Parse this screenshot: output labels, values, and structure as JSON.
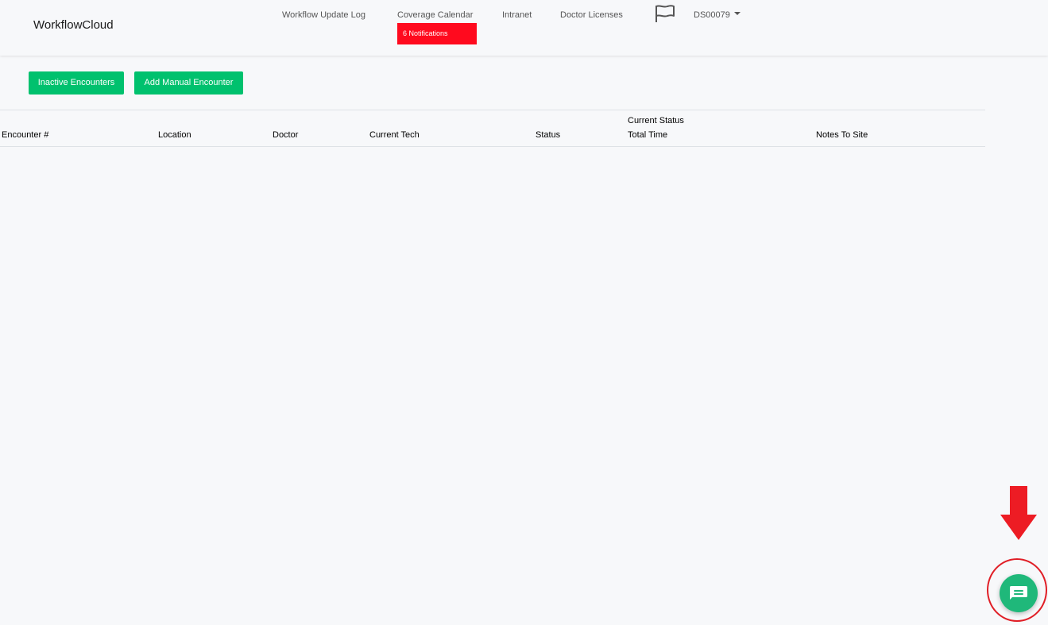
{
  "header": {
    "brand": "WorkflowCloud",
    "nav": [
      {
        "label": "Workflow Update Log"
      },
      {
        "label": "Coverage Calendar"
      },
      {
        "label": "Intranet"
      },
      {
        "label": "Doctor Licenses"
      }
    ],
    "notifications_badge": "6 Notifications",
    "user": "DS00079",
    "icons": {
      "flag": "flag-icon",
      "user_menu": "chevron-down-icon"
    }
  },
  "actions": {
    "inactive_encounters": "Inactive Encounters",
    "add_manual_encounter": "Add Manual Encounter"
  },
  "table": {
    "columns": [
      "Encounter #",
      "Location",
      "Doctor",
      "Current Tech",
      "Status",
      "Total Time",
      "Notes To Site"
    ],
    "current_status_group": "Current Status",
    "rows": []
  },
  "chat": {
    "icon": "chat-icon",
    "annotation_icon": "down-arrow-icon"
  },
  "colors": {
    "button_green": "#00c16e",
    "notification_red": "#ff0a1e",
    "chat_green": "#1fb87a",
    "annotation_red": "#e01e26"
  }
}
